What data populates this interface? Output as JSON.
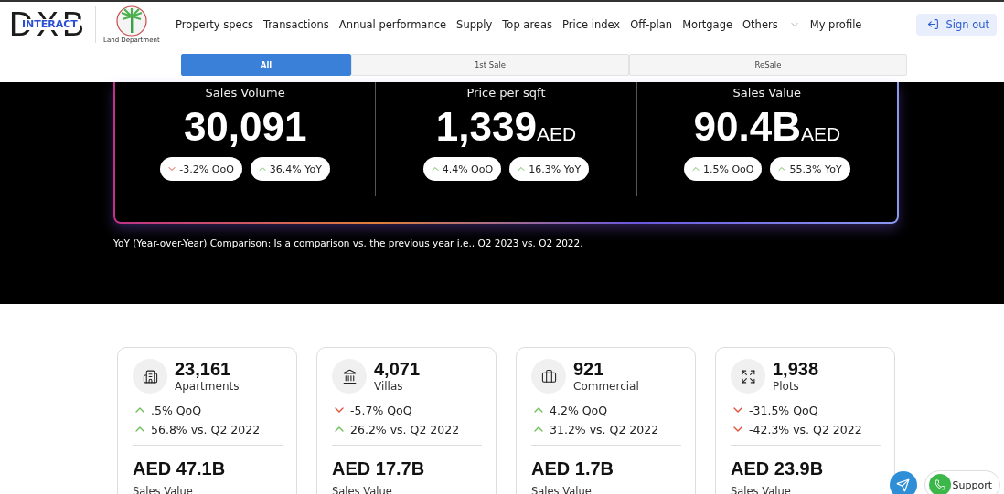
{
  "header": {
    "logo": {
      "main": "DXB",
      "sub": "INTERACT",
      "emblem_caption": "Land Department"
    },
    "nav": [
      {
        "label": "Property specs",
        "kind": "link"
      },
      {
        "label": "Transactions",
        "kind": "link"
      },
      {
        "label": "Annual performance",
        "kind": "link"
      },
      {
        "label": "Supply",
        "kind": "link"
      },
      {
        "label": "Top areas",
        "kind": "link"
      },
      {
        "label": "Price index",
        "kind": "link"
      },
      {
        "label": "Off-plan",
        "kind": "link"
      },
      {
        "label": "Mortgage",
        "kind": "link"
      },
      {
        "label": "Others",
        "kind": "dropdown"
      },
      {
        "label": "My profile",
        "kind": "link"
      }
    ],
    "sign_out": "Sign out"
  },
  "tabs": [
    {
      "label": "All",
      "selected": true
    },
    {
      "label": "1st Sale",
      "selected": false
    },
    {
      "label": "ReSale",
      "selected": false
    }
  ],
  "summary": [
    {
      "label": "Sales Volume",
      "value": "30,091",
      "changes": [
        {
          "text": "-3.2% QoQ",
          "kind": "down"
        },
        {
          "text": "36.4% YoY",
          "kind": "up"
        }
      ]
    },
    {
      "label": "Price per sqft",
      "value": "1,339",
      "unit": "AED",
      "changes": [
        {
          "text": "4.4% QoQ",
          "kind": "up"
        },
        {
          "text": "16.3% YoY",
          "kind": "up"
        }
      ]
    },
    {
      "label": "Sales Value",
      "value": "90.4B",
      "unit": "AED",
      "changes": [
        {
          "text": "1.5% QoQ",
          "kind": "up"
        },
        {
          "text": "55.3% YoY",
          "kind": "up"
        }
      ]
    }
  ],
  "note": "YoY (Year-over-Year) Comparison: Is a comparison vs. the previous year i.e., Q2 2023 vs. Q2 2022.",
  "categories": [
    {
      "kind": "apartments",
      "count": "23,161",
      "label": "Apartments",
      "changes": [
        {
          "text": ".5% QoQ",
          "kind": "up"
        },
        {
          "text": "56.8% vs. Q2 2022",
          "kind": "up"
        }
      ],
      "value": "AED 47.1B",
      "value_label": "Sales Value"
    },
    {
      "kind": "villas",
      "count": "4,071",
      "label": "Villas",
      "changes": [
        {
          "text": "-5.7% QoQ",
          "kind": "down"
        },
        {
          "text": "26.2% vs. Q2 2022",
          "kind": "up"
        }
      ],
      "value": "AED 17.7B",
      "value_label": "Sales Value"
    },
    {
      "kind": "commercial",
      "count": "921",
      "label": "Commercial",
      "changes": [
        {
          "text": "4.2% QoQ",
          "kind": "up"
        },
        {
          "text": "31.2% vs. Q2 2022",
          "kind": "up"
        }
      ],
      "value": "AED 1.7B",
      "value_label": "Sales Value"
    },
    {
      "kind": "plots",
      "count": "1,938",
      "label": "Plots",
      "changes": [
        {
          "text": "-31.5% QoQ",
          "kind": "down"
        },
        {
          "text": "-42.3% vs. Q2 2022",
          "kind": "down"
        }
      ],
      "value": "AED 23.9B",
      "value_label": "Sales Value"
    }
  ],
  "support": {
    "label": "Support"
  }
}
